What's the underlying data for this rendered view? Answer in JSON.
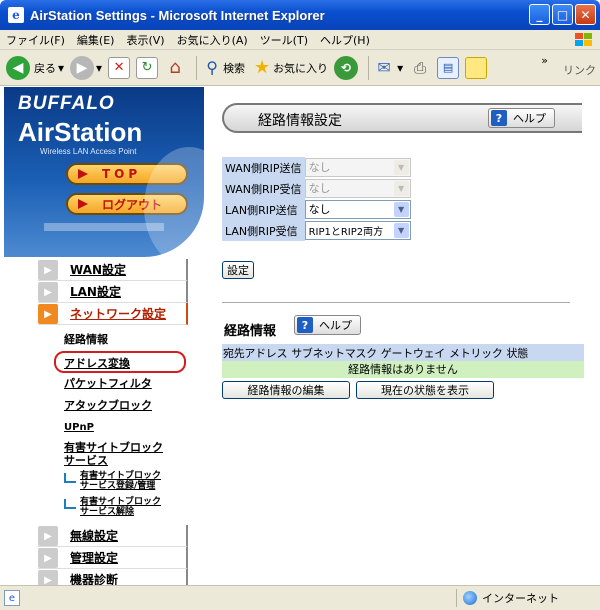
{
  "window": {
    "title": "AirStation Settings - Microsoft Internet Explorer"
  },
  "menu": [
    "ファイル(F)",
    "編集(E)",
    "表示(V)",
    "お気に入り(A)",
    "ツール(T)",
    "ヘルプ(H)"
  ],
  "toolbar": {
    "back_label": "戻る",
    "search_label": "検索",
    "favorites_label": "お気に入り",
    "links_label": "リンク"
  },
  "brand": {
    "buffalo": "BUFFALO",
    "airstation": "AirStation",
    "subtitle": "Wireless LAN Access Point",
    "top_button": "TOP",
    "logout_button": "ログアウト"
  },
  "nav": {
    "wan": "WAN設定",
    "lan": "LAN設定",
    "network": "ネットワーク設定",
    "sub": {
      "routing": "経路情報",
      "address": "アドレス変換",
      "packet_filter": "パケットフィルタ",
      "attack_block": "アタックブロック",
      "upnp": "UPnP",
      "harmful_site_1": "有害サイトブロック",
      "harmful_site_2": "サービス",
      "harmful_reg_1": "有害サイトブロック",
      "harmful_reg_2": "サービス登録/管理",
      "harmful_cancel_1": "有害サイトブロック",
      "harmful_cancel_2": "サービス解除"
    },
    "wireless": "無線設定",
    "admin": "管理設定",
    "diag": "機器診断"
  },
  "main": {
    "page_title": "経路情報設定",
    "help_label": "ヘルプ",
    "rip": [
      {
        "label": "WAN側RIP送信",
        "value": "なし",
        "disabled": true
      },
      {
        "label": "WAN側RIP受信",
        "value": "なし",
        "disabled": true
      },
      {
        "label": "LAN側RIP送信",
        "value": "なし",
        "disabled": false
      },
      {
        "label": "LAN側RIP受信",
        "value": "RIP1とRIP2両方",
        "disabled": false
      }
    ],
    "set_button": "設定",
    "routing_section_title": "経路情報",
    "routing_headers": [
      "宛先アドレス",
      "サブネットマスク",
      "ゲートウェイ",
      "メトリック",
      "状態"
    ],
    "routing_empty": "経路情報はありません",
    "edit_button": "経路情報の編集",
    "status_button": "現在の状態を表示"
  },
  "status": {
    "zone": "インターネット"
  }
}
